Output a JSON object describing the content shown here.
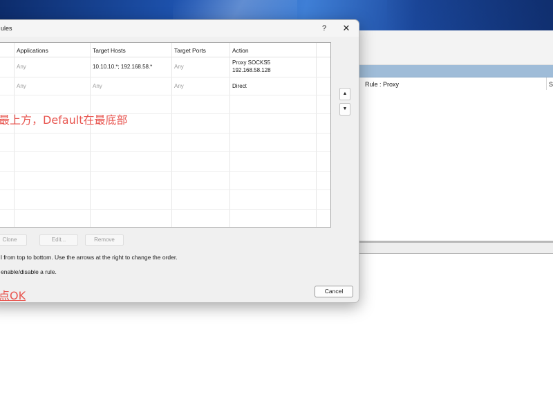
{
  "dialog": {
    "title": "ules",
    "help_label": "?",
    "close_label": "✕"
  },
  "table": {
    "headers": [
      "Applications",
      "Target Hosts",
      "Target Ports",
      "Action"
    ],
    "rows": [
      {
        "applications": "Any",
        "target_hosts": "10.10.10.*; 192.168.58.*",
        "target_ports": "Any",
        "action_line1": "Proxy SOCKS5",
        "action_line2": "192.168.58.128"
      },
      {
        "applications": "Any",
        "target_hosts": "Any",
        "target_ports": "Any",
        "action_line1": "Direct",
        "action_line2": ""
      }
    ]
  },
  "order_buttons": {
    "up": "▲",
    "down": "▼"
  },
  "buttons": {
    "clone": "Clone",
    "edit": "Edit...",
    "remove": "Remove",
    "cancel": "Cancel"
  },
  "hints": {
    "line1": "l from top to bottom. Use the arrows at the right to change the order.",
    "line2": "enable/disable a rule."
  },
  "annotations": {
    "top": "最上方，Default在最底部",
    "bottom": "点OK",
    "color": "#e8554f"
  },
  "background_window": {
    "header_rule": "Rule : Proxy",
    "header_s": "S"
  }
}
